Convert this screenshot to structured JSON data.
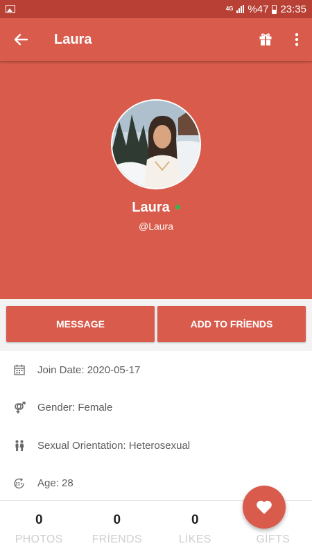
{
  "status_bar": {
    "network": "4G",
    "battery": "%47",
    "time": "23:35"
  },
  "app_bar": {
    "title": "Laura",
    "back_icon": "arrow-left-icon",
    "gift_icon": "gift-icon",
    "menu_icon": "more-vertical-icon"
  },
  "profile": {
    "name": "Laura",
    "handle": "@Laura",
    "online": true
  },
  "buttons": {
    "message": "MESSAGE",
    "add_friends": "ADD TO FRİENDS"
  },
  "info": [
    {
      "icon": "calendar-icon",
      "text": "Join Date: 2020-05-17"
    },
    {
      "icon": "gender-icon",
      "text": "Gender: Female"
    },
    {
      "icon": "people-icon",
      "text": "Sexual Orientation: Heterosexual"
    },
    {
      "icon": "age-21-icon",
      "text": "Age: 28"
    }
  ],
  "stats": [
    {
      "value": "0",
      "label": "PHOTOS"
    },
    {
      "value": "0",
      "label": "FRİENDS"
    },
    {
      "value": "0",
      "label": "LİKES"
    },
    {
      "value": "",
      "label": "GİFTS"
    }
  ],
  "fab": {
    "icon": "heart-icon"
  },
  "colors": {
    "primary": "#d95b4c",
    "status_bar": "#b84034",
    "online": "#3cb44a"
  }
}
